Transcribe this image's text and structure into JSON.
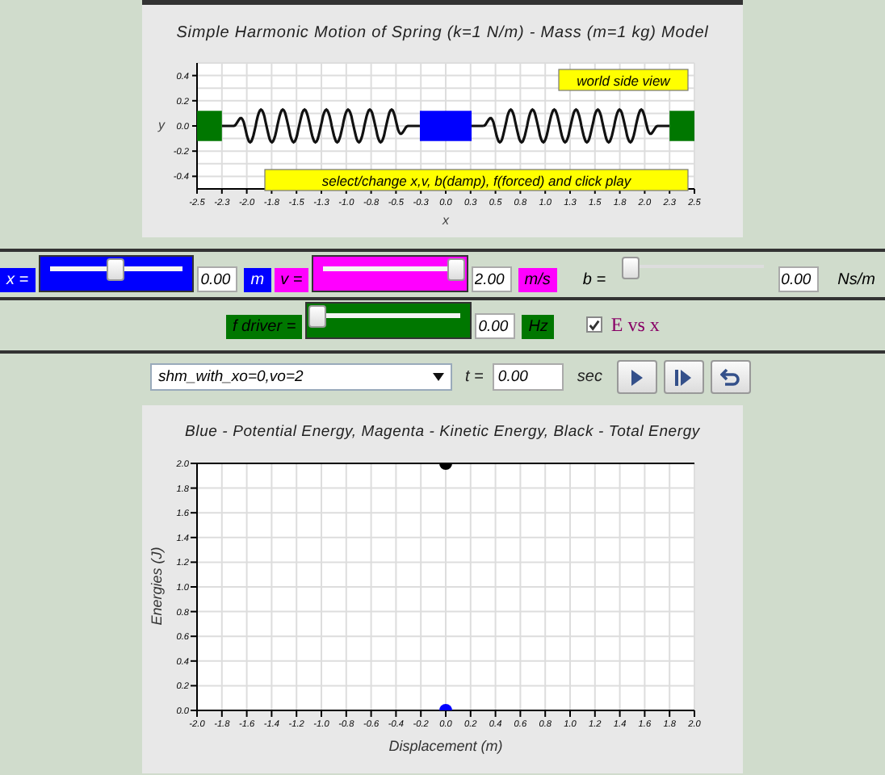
{
  "world_view": {
    "title": "Simple Harmonic Motion of Spring (k=1 N/m) - Mass (m=1 kg) Model",
    "x_label": "x",
    "y_label": "y",
    "x_ticks": [
      "-2.5",
      "-2.3",
      "-2.0",
      "-1.8",
      "-1.5",
      "-1.3",
      "-1.0",
      "-0.8",
      "-0.5",
      "-0.3",
      "0.0",
      "0.3",
      "0.5",
      "0.8",
      "1.0",
      "1.3",
      "1.5",
      "1.8",
      "2.0",
      "2.3",
      "2.5"
    ],
    "y_ticks": [
      "0.4",
      "0.2",
      "0.0",
      "-0.2",
      "-0.4"
    ],
    "view_label": "world side view",
    "hint": "select/change x,v, b(damp), f(forced) and click play"
  },
  "control_rows": [
    {
      "items": [
        {
          "kind": "slider",
          "label": "x =",
          "level": 0.5,
          "value": "0.00",
          "unit": "m",
          "color": "#0000ff"
        },
        {
          "kind": "slider",
          "label": "v =",
          "level": 1.0,
          "value": "2.00",
          "unit": "m/s",
          "color": "#ff00ff"
        },
        {
          "kind": "slider",
          "label": "b =",
          "level": 0.0,
          "value": "0.00",
          "unit": "Ns/m"
        }
      ]
    },
    {
      "items": [
        {
          "kind": "slider",
          "label": "f driver =",
          "level": 0.0,
          "value": "0.00",
          "unit": "Hz",
          "color": "#007700"
        },
        {
          "kind": "checkbox",
          "label": "E vs x",
          "checked": true
        }
      ]
    }
  ],
  "playback": {
    "scenario": "shm_with_xo=0,vo=2",
    "time_label": "t =",
    "time": "0.00",
    "time_unit": "sec",
    "buttons": [
      {
        "kind": "play"
      },
      {
        "kind": "step"
      },
      {
        "kind": "reset"
      }
    ]
  },
  "energy_chart": {
    "chart_data": {
      "type": "scatter",
      "title": "Blue - Potential Energy, Magenta - Kinetic Energy, Black - Total Energy",
      "xlabel": "Displacement (m)",
      "ylabel": "Energies (J)",
      "x": [
        0
      ],
      "series": [
        {
          "color": "#000000",
          "values": [
            2.0
          ]
        },
        {
          "color": "#0000ff",
          "values": [
            0.0
          ]
        }
      ],
      "grid": true,
      "xlim": [
        -2,
        2
      ],
      "ylim": [
        0,
        2
      ],
      "xticks": [
        {
          "value": -2,
          "label": "-2.0"
        },
        {
          "value": -1.8,
          "label": "-1.8"
        },
        {
          "value": -1.6,
          "label": "-1.6"
        },
        {
          "value": -1.4,
          "label": "-1.4"
        },
        {
          "value": -1.2,
          "label": "-1.2"
        },
        {
          "value": -1,
          "label": "-1.0"
        },
        {
          "value": -0.8,
          "label": "-0.8"
        },
        {
          "value": -0.6,
          "label": "-0.6"
        },
        {
          "value": -0.4,
          "label": "-0.4"
        },
        {
          "value": -0.2,
          "label": "-0.2"
        },
        {
          "value": 0,
          "label": "0.0"
        },
        {
          "value": 0.2,
          "label": "0.2"
        },
        {
          "value": 0.4,
          "label": "0.4"
        },
        {
          "value": 0.6,
          "label": "0.6"
        },
        {
          "value": 0.8,
          "label": "0.8"
        },
        {
          "value": 1,
          "label": "1.0"
        },
        {
          "value": 1.2,
          "label": "1.2"
        },
        {
          "value": 1.4,
          "label": "1.4"
        },
        {
          "value": 1.6,
          "label": "1.6"
        },
        {
          "value": 1.8,
          "label": "1.8"
        },
        {
          "value": 2,
          "label": "2.0"
        }
      ],
      "yticks": [
        {
          "value": 0,
          "label": "0.0"
        },
        {
          "value": 0.2,
          "label": "0.2"
        },
        {
          "value": 0.4,
          "label": "0.4"
        },
        {
          "value": 0.6,
          "label": "0.6"
        },
        {
          "value": 0.8,
          "label": "0.8"
        },
        {
          "value": 1,
          "label": "1.0"
        },
        {
          "value": 1.2,
          "label": "1.2"
        },
        {
          "value": 1.4,
          "label": "1.4"
        },
        {
          "value": 1.6,
          "label": "1.6"
        },
        {
          "value": 1.8,
          "label": "1.8"
        },
        {
          "value": 2,
          "label": "2.0"
        }
      ]
    }
  }
}
